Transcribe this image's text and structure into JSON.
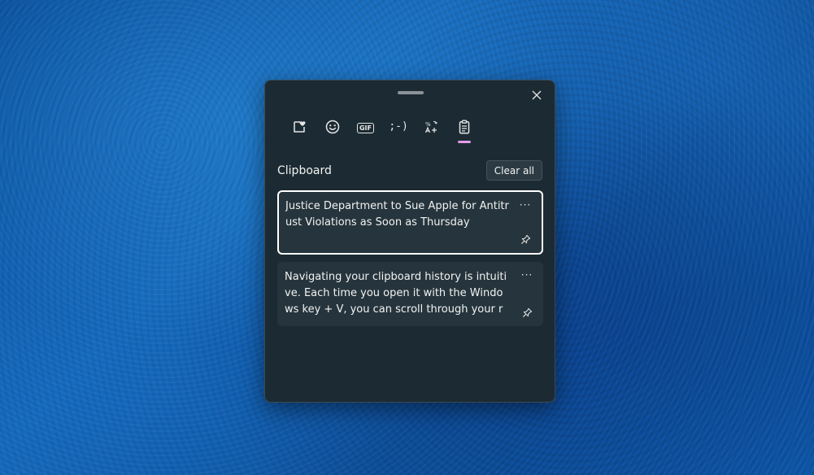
{
  "window": {
    "close_icon": "close-icon"
  },
  "tabs": [
    {
      "name": "recently-used",
      "icon": "heart-note-icon"
    },
    {
      "name": "emoji",
      "icon": "smiley-icon"
    },
    {
      "name": "gif",
      "icon": "gif-icon",
      "label": "GIF"
    },
    {
      "name": "kaomoji",
      "icon": "kaomoji-icon",
      "label": ";-)"
    },
    {
      "name": "symbols",
      "icon": "symbols-icon"
    },
    {
      "name": "clipboard",
      "icon": "clipboard-icon",
      "active": true
    }
  ],
  "clipboard": {
    "title": "Clipboard",
    "clear_all_label": "Clear all",
    "items": [
      {
        "text": "Justice Department to Sue Apple for Antitrust Violations as Soon as Thursday",
        "selected": true
      },
      {
        "text": "Navigating your clipboard history is intuitive. Each time you open it with the Windows key + V, you can scroll through your recent",
        "selected": false
      }
    ]
  },
  "colors": {
    "panel_bg": "#1c2b33",
    "item_bg": "#26353d",
    "accent_underline": "#e39be8",
    "text": "#f2f2f2"
  }
}
